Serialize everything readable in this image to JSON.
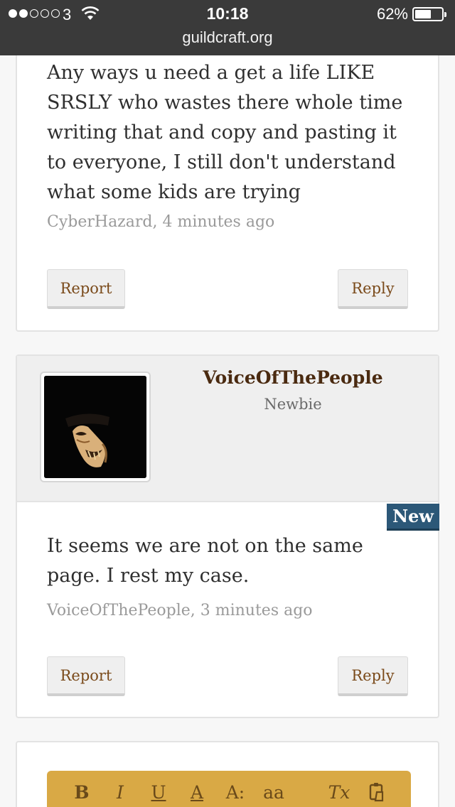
{
  "status_bar": {
    "carrier": "3",
    "time": "10:18",
    "battery_percent": "62%",
    "battery_level": 0.62
  },
  "browser": {
    "url": "guildcraft.org"
  },
  "post1": {
    "text": "Any ways u need a get a life LIKE SRSLY who wastes there whole time writing that and copy and pasting it to everyone, I still don't understand what some kids are trying",
    "meta": "CyberHazard, 4 minutes ago",
    "report_label": "Report",
    "reply_label": "Reply"
  },
  "post2": {
    "author": "VoiceOfThePeople",
    "rank": "Newbie",
    "badge": "New",
    "text": "It seems we are not on the same page. I rest my case.",
    "meta": "VoiceOfThePeople, 3 minutes ago",
    "report_label": "Report",
    "reply_label": "Reply"
  },
  "editor": {
    "toolbar": {
      "bold": "B",
      "italic": "I",
      "underline": "U",
      "text_color": "A",
      "font_size": "A:",
      "case": "aa",
      "clear_format": "Tx"
    }
  },
  "colors": {
    "status_bar": "#3a3a3a",
    "button_text": "#7a4a1a",
    "author_name": "#4a2a10",
    "badge": "#2c5878",
    "editor_toolbar": "#d9a945"
  }
}
